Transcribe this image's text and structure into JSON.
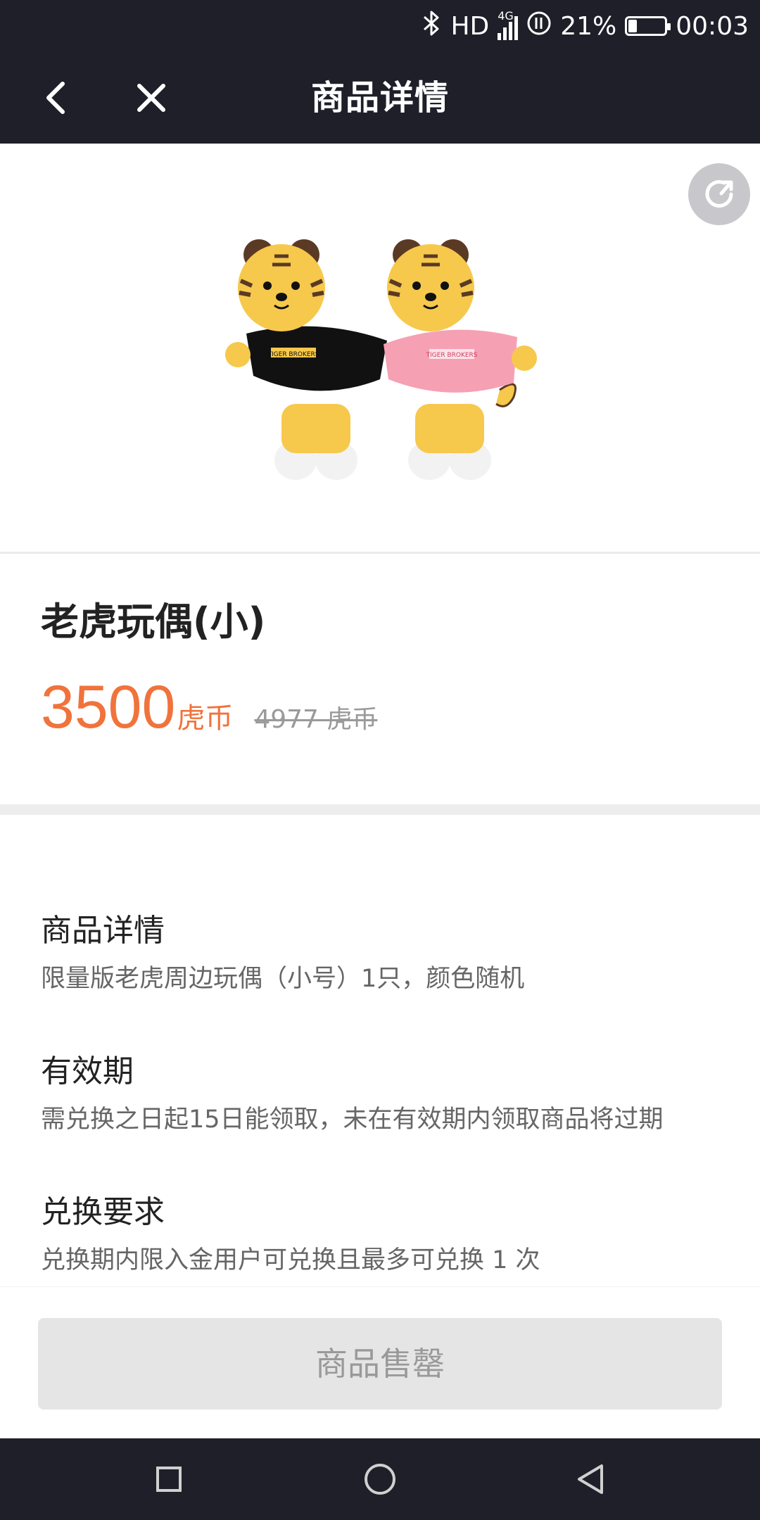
{
  "status_bar": {
    "network": "HD",
    "signal_label": "4G",
    "battery_percent": "21%",
    "battery_level": 0.21,
    "time": "00:03"
  },
  "header": {
    "title": "商品详情"
  },
  "hero": {
    "image_text": "TIGER BROKERS"
  },
  "product": {
    "name": "老虎玩偶(小)",
    "price": "3500",
    "price_unit": "虎币",
    "original_price": "4977 虎币"
  },
  "details": [
    {
      "title": "商品详情",
      "text": "限量版老虎周边玩偶（小号）1只，颜色随机"
    },
    {
      "title": "有效期",
      "text": "需兑换之日起15日能领取，未在有效期内领取商品将过期"
    },
    {
      "title": "兑换要求",
      "text": "兑换期内限入金用户可兑换且最多可兑换 1 次"
    }
  ],
  "action": {
    "button_label": "商品售罄"
  },
  "colors": {
    "accent": "#f0733c",
    "header_bg": "#1f1f2a",
    "soldout_bg": "#e5e5e5"
  },
  "icons": {
    "back": "chevron-left-icon",
    "close": "close-icon",
    "share": "share-icon",
    "nav_recent": "square-icon",
    "nav_home": "circle-icon",
    "nav_back": "triangle-left-icon"
  }
}
